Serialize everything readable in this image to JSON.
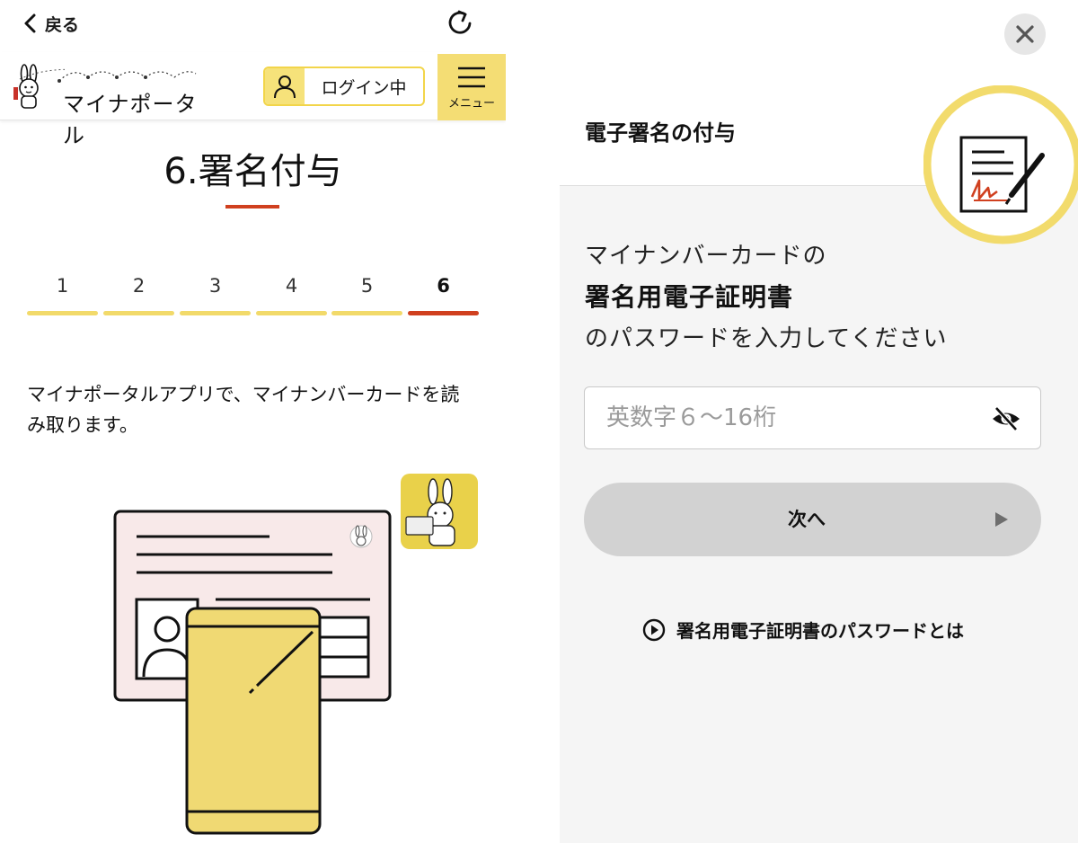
{
  "left": {
    "topbar": {
      "back_label": "戻る",
      "back_icon": "chevron-left-icon",
      "reload_icon": "reload-icon"
    },
    "header": {
      "logo_text": "マイナポータル",
      "login_label": "ログイン中",
      "menu_label": "メニュー"
    },
    "step_title": "6.署名付与",
    "steps": [
      {
        "label": "1",
        "active": false
      },
      {
        "label": "2",
        "active": false
      },
      {
        "label": "3",
        "active": false
      },
      {
        "label": "4",
        "active": false
      },
      {
        "label": "5",
        "active": false
      },
      {
        "label": "6",
        "active": true
      }
    ],
    "instruction": "マイナポータルアプリで、マイナンバーカードを読み取ります。",
    "colors": {
      "accent_yellow": "#f4dd74",
      "accent_red": "#d0401f"
    }
  },
  "right": {
    "title": "電子署名の付与",
    "close_icon": "close-icon",
    "prompt": {
      "line1": "マイナンバーカードの",
      "line2": "署名用電子証明書",
      "line3": "のパスワードを入力してください"
    },
    "password": {
      "placeholder": "英数字６〜16桁",
      "value": "",
      "toggle_icon": "eye-slash-icon"
    },
    "next_label": "次へ",
    "help_label": "署名用電子証明書のパスワードとは",
    "colors": {
      "panel_bg": "#f5f5f5",
      "button_bg": "#d2d2d2"
    }
  }
}
